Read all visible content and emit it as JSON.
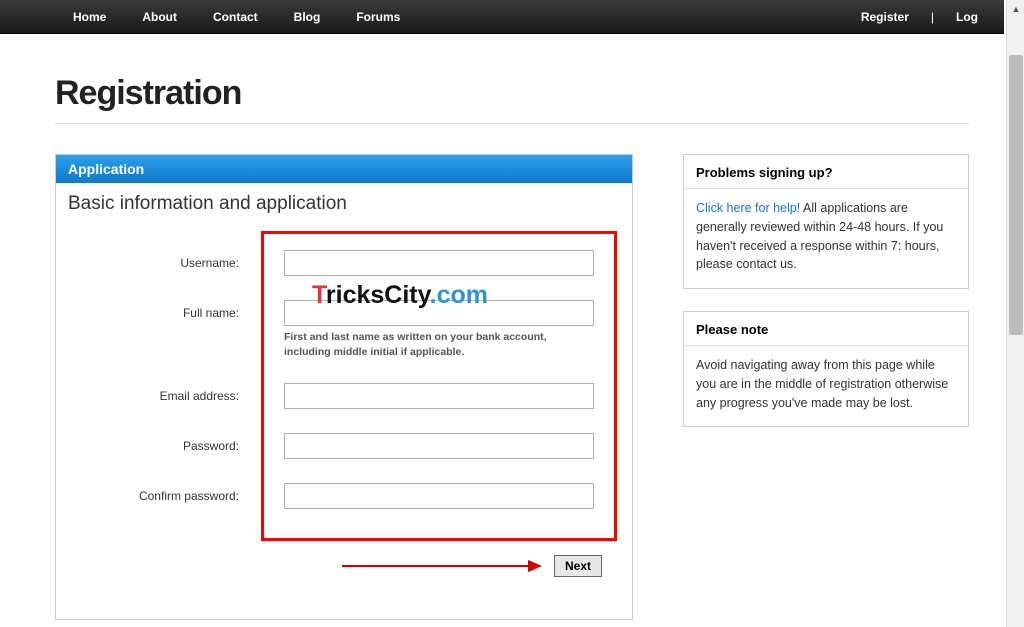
{
  "nav": {
    "left": [
      "Home",
      "About",
      "Contact",
      "Blog",
      "Forums"
    ],
    "right": {
      "register": "Register",
      "login": "Log",
      "divider": "|"
    }
  },
  "page": {
    "title": "Registration"
  },
  "panel": {
    "header": "Application",
    "section_title": "Basic information and application"
  },
  "form": {
    "username": {
      "label": "Username:",
      "value": ""
    },
    "fullname": {
      "label": "Full name:",
      "value": "",
      "hint": "First and last name as written on your bank account, including middle initial if applicable."
    },
    "email": {
      "label": "Email address:",
      "value": ""
    },
    "password": {
      "label": "Password:",
      "value": ""
    },
    "confirm": {
      "label": "Confirm password:",
      "value": ""
    },
    "next": "Next"
  },
  "sidebar": {
    "box1": {
      "title": "Problems signing up?",
      "link": "Click here for help!",
      "text": " All applications are generally reviewed within 24-48 hours. If you haven't received a response within 7: hours, please contact us."
    },
    "box2": {
      "title": "Please note",
      "text": "Avoid navigating away from this page while you are in the middle of registration otherwise any progress you've made may be lost."
    }
  },
  "watermark": {
    "p1": "T",
    "p2": "ricksCity",
    "p3": ".com"
  }
}
